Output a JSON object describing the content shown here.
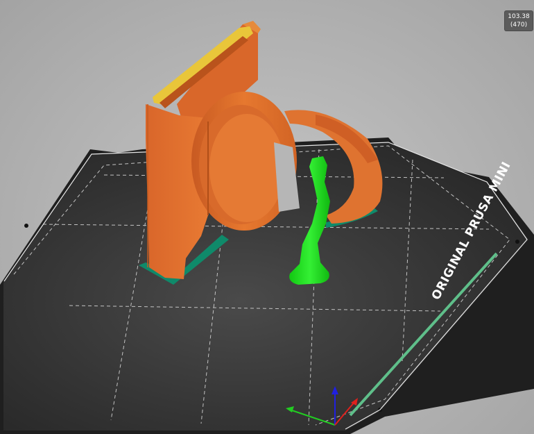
{
  "layer_indicator": {
    "height": "103.38",
    "layer": "(470)"
  },
  "bed": {
    "label": "ORIGINAL PRUSA MINI"
  },
  "colors": {
    "bed": "#2e2e2e",
    "bed_edge": "#1e1e1e",
    "grid": "#bdbdbd",
    "perimeter": "#e06d2b",
    "perimeter_shadow": "#b9531c",
    "top_infill": "#e9c63a",
    "support": "#19e619",
    "skirt": "#0f8a6a",
    "axis_x": "#e0201c",
    "axis_y": "#22cc22",
    "axis_z": "#2020e0",
    "indicator_bg": "#5b5b5b"
  }
}
